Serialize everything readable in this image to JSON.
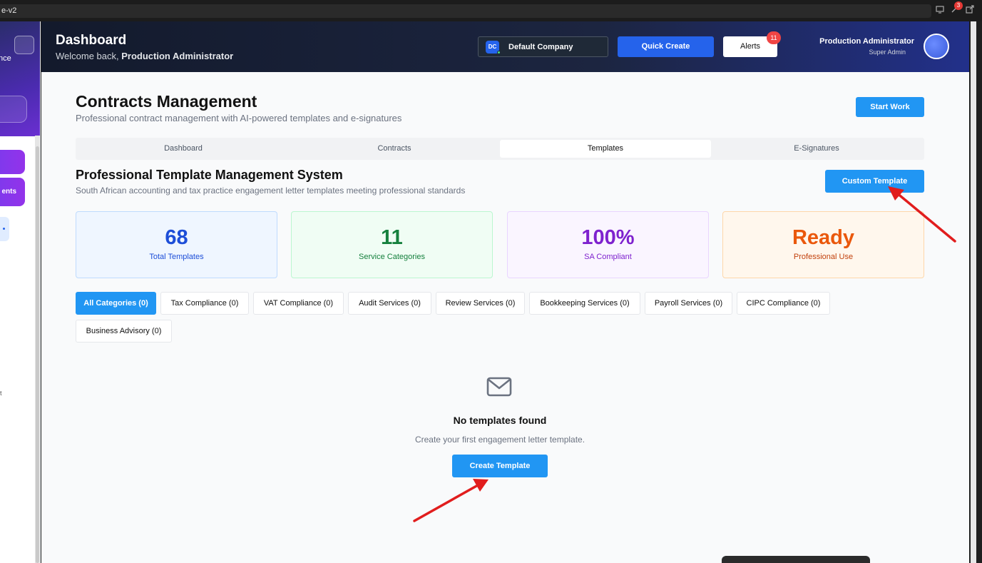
{
  "browser": {
    "tab_title": "e-v2",
    "notification_count": "3"
  },
  "sidebar": {
    "partial_label_top": "nce",
    "partial_label_active": "ents",
    "partial_mark": "t"
  },
  "header": {
    "title": "Dashboard",
    "welcome_prefix": "Welcome back, ",
    "welcome_name": "Production Administrator",
    "company_initials": "DC",
    "company_name": "Default Company",
    "quick_create": "Quick Create",
    "alerts": "Alerts",
    "alerts_count": "11",
    "user_name": "Production Administrator",
    "user_role": "Super Admin"
  },
  "page": {
    "title": "Contracts Management",
    "subtitle": "Professional contract management with AI-powered templates and e-signatures",
    "start_work": "Start Work",
    "tabs": [
      {
        "label": "Dashboard"
      },
      {
        "label": "Contracts"
      },
      {
        "label": "Templates"
      },
      {
        "label": "E-Signatures"
      }
    ],
    "active_tab": "Templates"
  },
  "templates": {
    "title": "Professional Template Management System",
    "subtitle": "South African accounting and tax practice engagement letter templates meeting professional standards",
    "custom_template": "Custom Template",
    "stats": [
      {
        "value": "68",
        "label": "Total Templates"
      },
      {
        "value": "11",
        "label": "Service Categories"
      },
      {
        "value": "100%",
        "label": "SA Compliant"
      },
      {
        "value": "Ready",
        "label": "Professional Use"
      }
    ],
    "categories": [
      {
        "label": "All Categories (0)"
      },
      {
        "label": "Tax Compliance (0)"
      },
      {
        "label": "VAT Compliance (0)"
      },
      {
        "label": "Audit Services (0)"
      },
      {
        "label": "Review Services (0)"
      },
      {
        "label": "Bookkeeping Services (0)"
      },
      {
        "label": "Payroll Services (0)"
      },
      {
        "label": "CIPC Compliance (0)"
      },
      {
        "label": "Business Advisory (0)"
      }
    ],
    "selected_category": "All Categories (0)",
    "empty_title": "No templates found",
    "empty_subtitle": "Create your first engagement letter template.",
    "create_template": "Create Template"
  },
  "colors": {
    "primary": "#2196f3",
    "annotation_arrow": "#e11d1d",
    "header_bg": "#131a2c"
  }
}
